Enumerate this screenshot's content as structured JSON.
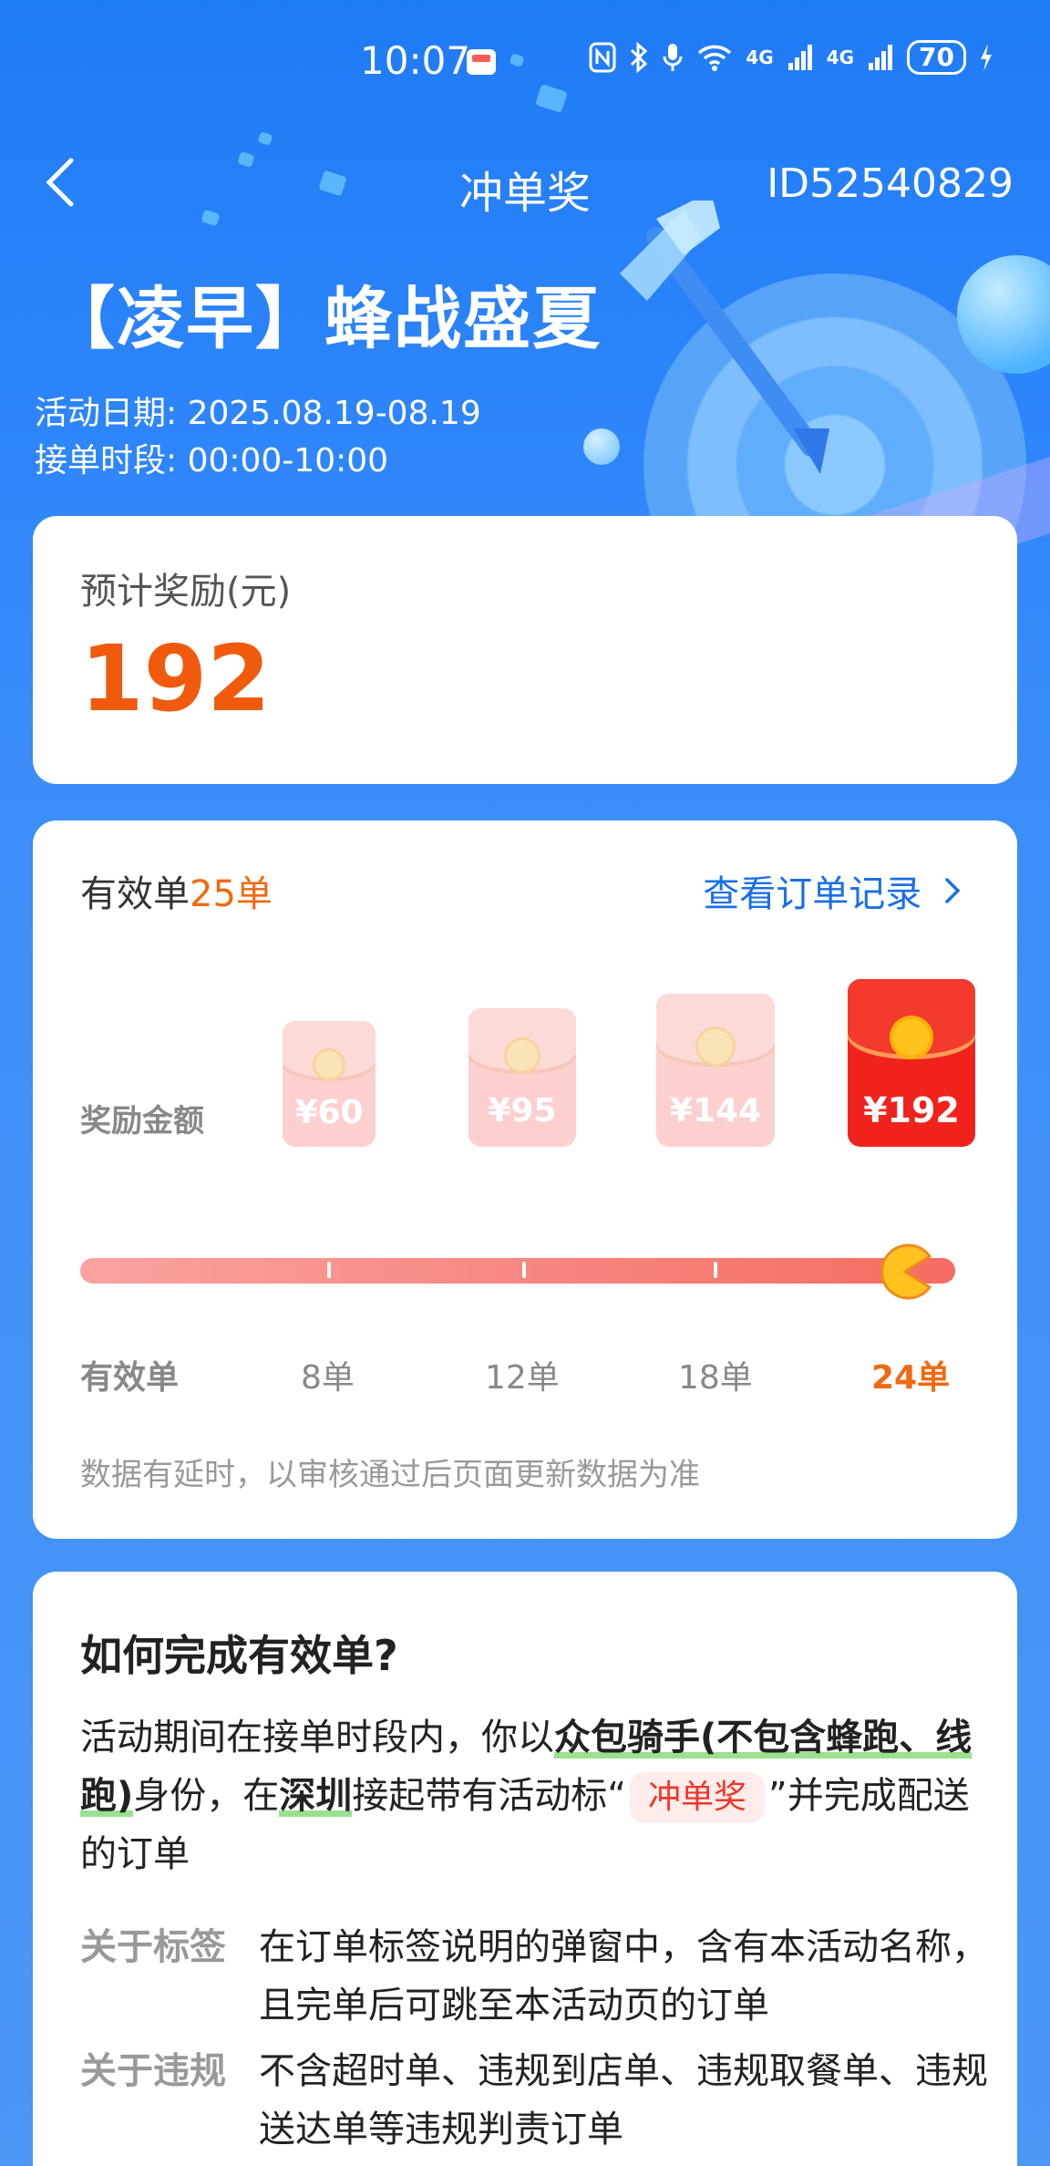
{
  "status_bar": {
    "time": "10:07",
    "battery": "70",
    "network": "4G",
    "icons": [
      "nfc-icon",
      "bluetooth-icon",
      "mic-icon",
      "wifi-icon",
      "signal-icon",
      "signal-icon",
      "charging-icon"
    ]
  },
  "nav": {
    "title": "冲单奖",
    "id_text": "ID52540829"
  },
  "activity": {
    "title": "【凌早】蜂战盛夏",
    "date_text": "活动日期: 2025.08.19-08.19",
    "time_text": "接单时段: 00:00-10:00"
  },
  "estimate": {
    "label": "预计奖励(元)",
    "value": "192"
  },
  "progress": {
    "valid_prefix": "有效单",
    "valid_count": "25单",
    "view_orders": "查看订单记录",
    "reward_label": "奖励金额",
    "rewards": [
      {
        "amount": "¥60",
        "achieved": false
      },
      {
        "amount": "¥95",
        "achieved": false
      },
      {
        "amount": "¥144",
        "achieved": false
      },
      {
        "amount": "¥192",
        "achieved": true
      }
    ],
    "steps_label": "有效单",
    "steps": [
      "8单",
      "12单",
      "18单",
      "24单"
    ],
    "active_step": 3,
    "fill_fraction": 1.0,
    "note": "数据有延时，以审核通过后页面更新数据为准"
  },
  "how": {
    "title": "如何完成有效单?",
    "body_1": "活动期间在接单时段内，你以",
    "body_hl_1": "众包骑手(不包含蜂跑、线跑)",
    "body_2": "身份，在",
    "body_hl_2": "深圳",
    "body_3": "接起带有活动标“",
    "body_tag": "冲单奖",
    "body_4": "”并完成配送的订单",
    "rules": [
      {
        "key": "关于标签",
        "value": "在订单标签说明的弹窗中，含有本活动名称，且完单后可跳至本活动页的订单"
      },
      {
        "key": "关于违规",
        "value": "不含超时单、违规到店单、违规取餐单、违规送达单等违规判责订单"
      }
    ]
  },
  "colors": {
    "brand_blue": "#1f7bf5",
    "accent_orange": "#f05a0c",
    "link_blue": "#1a6fe8",
    "envelope_red": "#f0231c"
  }
}
